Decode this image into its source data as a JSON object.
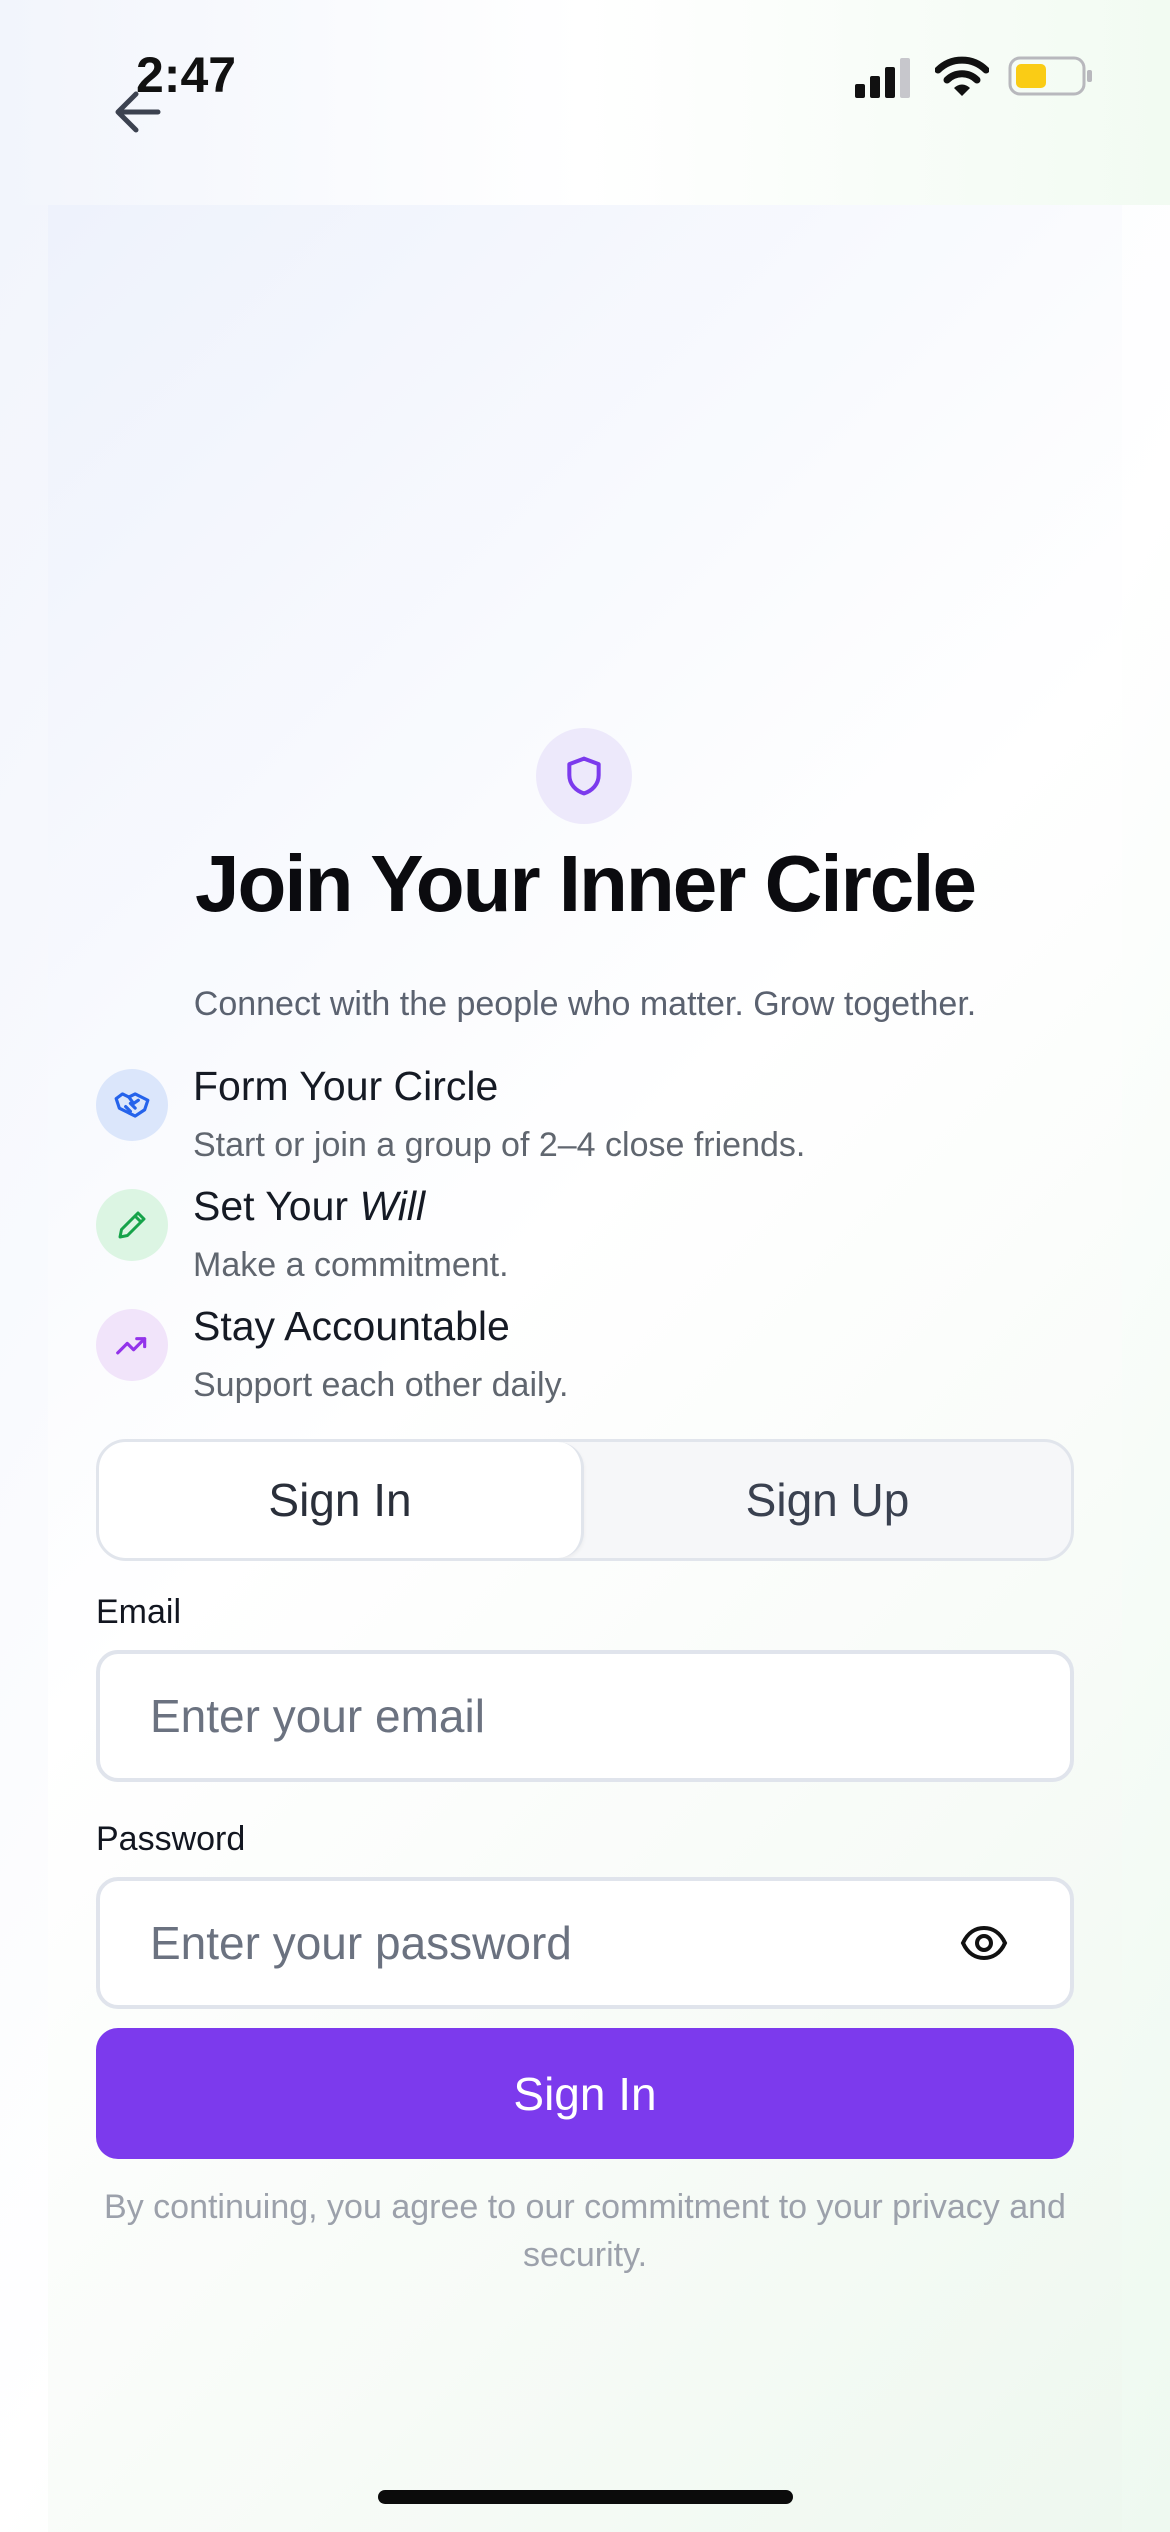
{
  "status_bar": {
    "time": "2:47",
    "icons": [
      "signal-icon",
      "wifi-icon",
      "battery-icon"
    ],
    "battery_color": "#facc15"
  },
  "nav": {
    "back_icon": "arrow-left-icon"
  },
  "hero": {
    "icon": "shield-icon",
    "title": "Join Your Inner Circle",
    "subtitle": "Connect with the people who matter. Grow together."
  },
  "features": [
    {
      "icon": "handshake-icon",
      "title": "Form Your Circle",
      "description": "Start or join a group of 2–4 close friends.",
      "color": "#2563eb",
      "bg": "#dbe6fb"
    },
    {
      "icon": "pencil-icon",
      "title_prefix": "Set Your ",
      "title_emphasis": "Will",
      "description": "Make a commitment.",
      "color": "#16a34a",
      "bg": "#dcf5e3"
    },
    {
      "icon": "trending-up-icon",
      "title": "Stay Accountable",
      "description": "Support each other daily.",
      "color": "#9333ea",
      "bg": "#f1e4fa"
    }
  ],
  "tabs": {
    "sign_in": "Sign In",
    "sign_up": "Sign Up",
    "active": "sign_in"
  },
  "form": {
    "email_label": "Email",
    "email_placeholder": "Enter your email",
    "email_value": "",
    "password_label": "Password",
    "password_placeholder": "Enter your password",
    "password_value": "",
    "password_toggle_icon": "eye-icon",
    "submit_label": "Sign In"
  },
  "legal": "By continuing, you agree to our commitment to your privacy and security.",
  "colors": {
    "accent": "#7c3aed",
    "title": "#0b0b0f",
    "muted": "#6b7280"
  }
}
